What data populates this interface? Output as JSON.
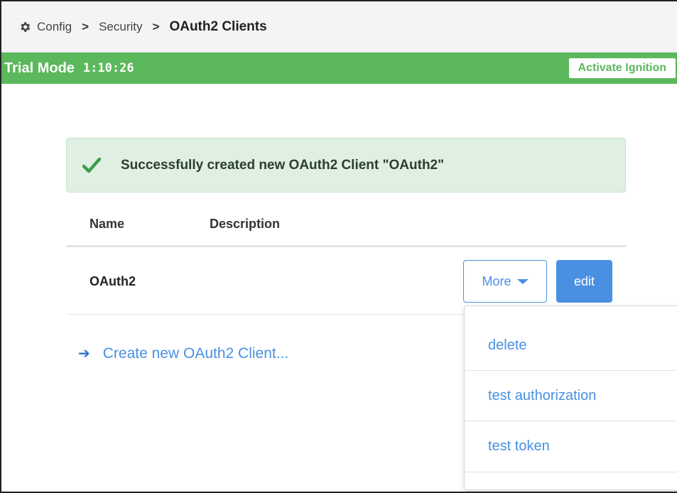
{
  "breadcrumb": {
    "items": [
      "Config",
      "Security"
    ],
    "separator": ">",
    "current": "OAuth2 Clients"
  },
  "trial": {
    "label": "Trial Mode",
    "time": "1:10:26",
    "activate_label": "Activate Ignition"
  },
  "alert": {
    "message": "Successfully created new OAuth2 Client \"OAuth2\""
  },
  "table": {
    "columns": [
      "Name",
      "Description"
    ],
    "rows": [
      {
        "name": "OAuth2",
        "description": ""
      }
    ],
    "more_label": "More",
    "edit_label": "edit"
  },
  "create_link": "Create new OAuth2 Client...",
  "dropdown": {
    "items": [
      "delete",
      "test authorization",
      "test token"
    ]
  },
  "colors": {
    "trial_green": "#5cb85c",
    "link_blue": "#4a90e2",
    "alert_bg": "#dff0e3",
    "check_green": "#3a9d4a"
  },
  "icons": [
    "gear-icon",
    "chevron-right-icon",
    "check-icon",
    "caret-down-icon",
    "arrow-right-icon"
  ]
}
